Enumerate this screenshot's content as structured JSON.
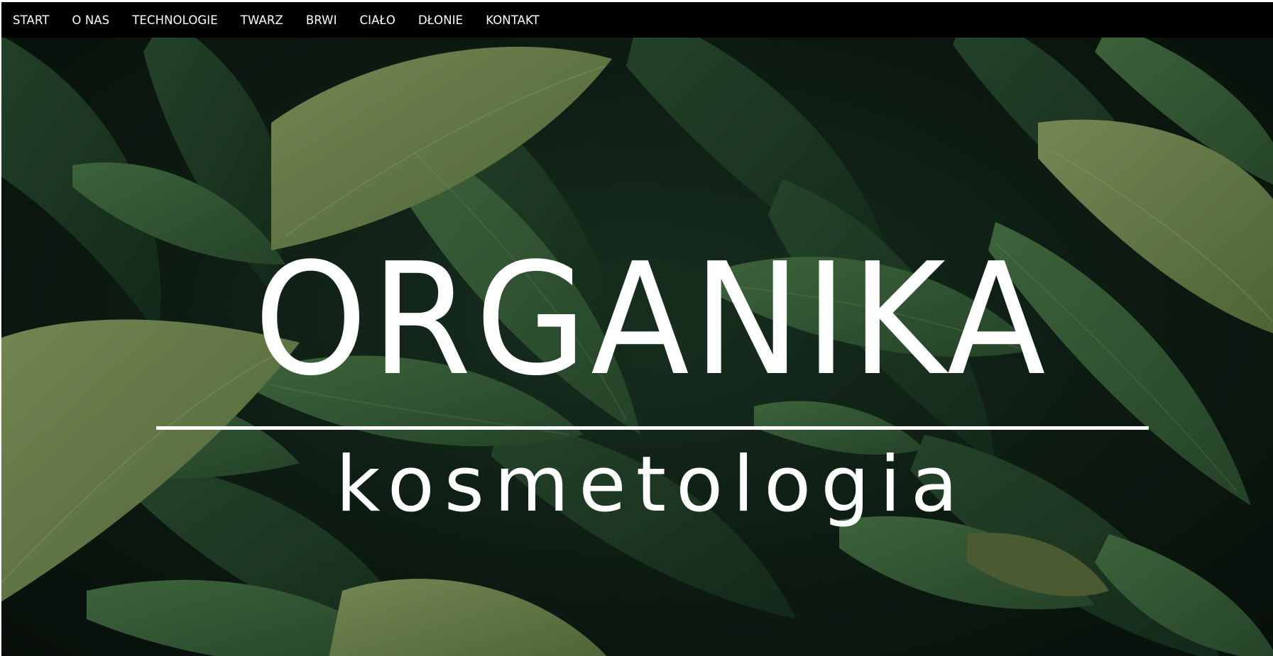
{
  "nav": {
    "items": [
      {
        "label": "START"
      },
      {
        "label": "O NAS"
      },
      {
        "label": "TECHNOLOGIE"
      },
      {
        "label": "TWARZ"
      },
      {
        "label": "BRWI"
      },
      {
        "label": "CIAŁO"
      },
      {
        "label": "DŁONIE"
      },
      {
        "label": "KONTAKT"
      }
    ]
  },
  "hero": {
    "title": "ORGANIKA",
    "subtitle": "kosmetologia",
    "background": "tropical-green-leaves-image"
  },
  "colors": {
    "nav_background": "#000000",
    "nav_text": "#ffffff",
    "logo_text": "#ffffff",
    "leaf_dark": "#1f3d27",
    "leaf_mid": "#3f6a3e",
    "leaf_light": "#7e9a5c"
  }
}
